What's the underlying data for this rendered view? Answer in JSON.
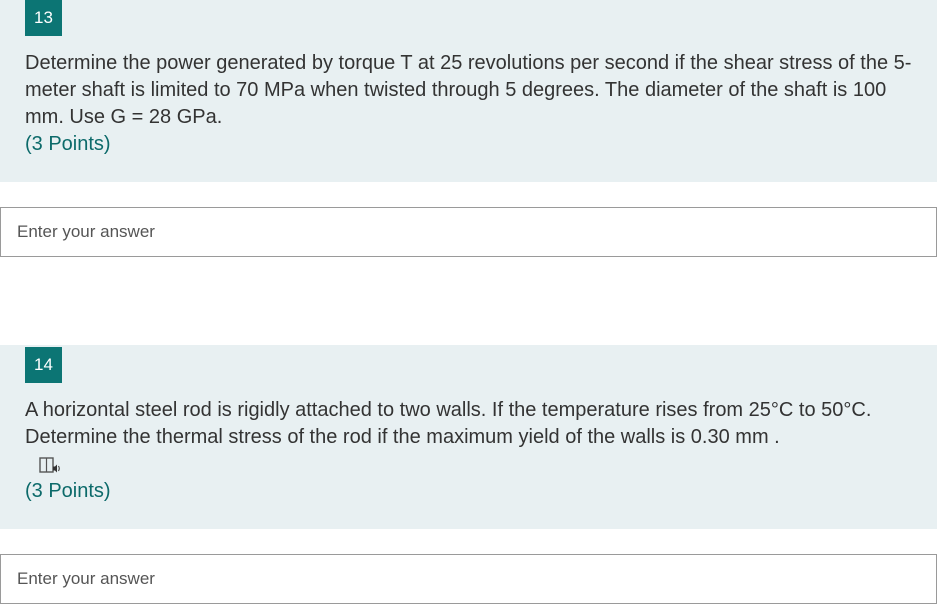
{
  "questions": [
    {
      "number": "13",
      "text": "Determine the power generated by torque T at 25 revolutions per second if the shear stress of the 5-meter shaft is limited to 70 MPa when twisted through 5 degrees. The diameter of the shaft is 100 mm. Use G = 28 GPa.",
      "points": "(3 Points)",
      "answer_placeholder": "Enter your answer",
      "answer_value": ""
    },
    {
      "number": "14",
      "text": "A horizontal steel rod is rigidly attached to two walls. If the temperature rises from 25°C to 50°C. Determine the thermal stress of the rod if the maximum yield of the walls is 0.30 mm .",
      "points": "(3 Points)",
      "answer_placeholder": "Enter your answer",
      "answer_value": "",
      "icon": "immersive-reader-icon"
    }
  ],
  "colors": {
    "question_background": "#e8f0f2",
    "number_badge": "#0c7574",
    "points_text": "#0c6a6a",
    "body_text": "#333333",
    "input_border": "#9a9a9a"
  }
}
